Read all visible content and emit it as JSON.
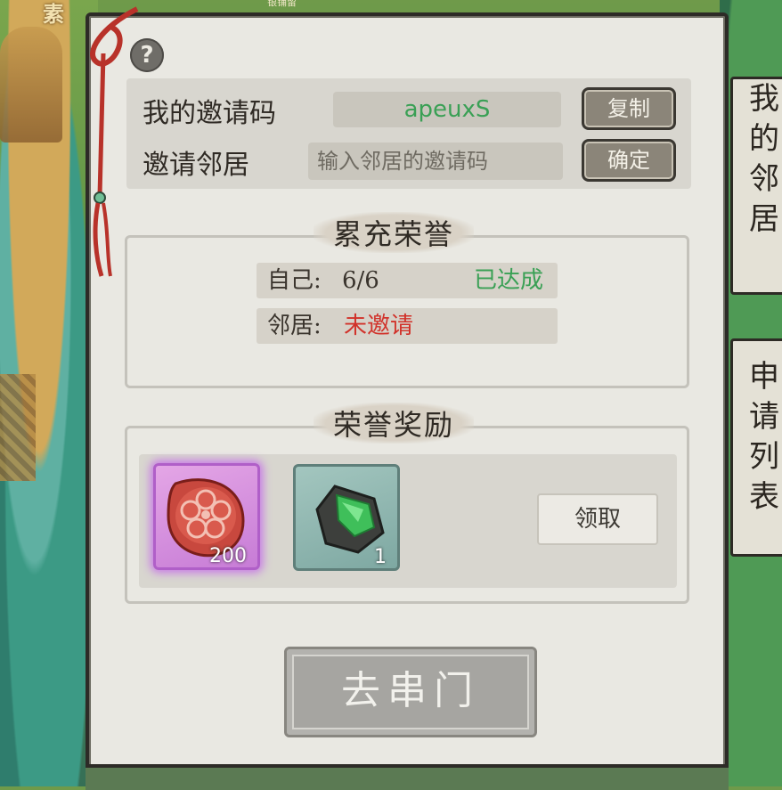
{
  "background": {
    "top_left_label": "素",
    "top_mini_label": "银铺留",
    "side_card_top": [
      "我",
      "的",
      "邻",
      "居"
    ],
    "side_card_bottom": [
      "申",
      "请",
      "列",
      "表"
    ]
  },
  "invite": {
    "my_code_label": "我的邀请码",
    "my_code_value": "apeuxS",
    "copy_button": "复制",
    "invite_label": "邀请邻居",
    "input_placeholder": "输入邻居的邀请码",
    "confirm_button": "确定"
  },
  "progress": {
    "title": "累充荣誉",
    "self_label": "自己:",
    "self_value": "6/6",
    "self_status": "已达成",
    "neighbor_label": "邻居:",
    "neighbor_status": "未邀请"
  },
  "rewards": {
    "title": "荣誉奖励",
    "items": [
      {
        "icon": "plum-blossom-token-icon",
        "count": "200"
      },
      {
        "icon": "jade-stone-icon",
        "count": "1"
      }
    ],
    "claim_button": "领取"
  },
  "visit_button": "去串门",
  "colors": {
    "success": "#3aa055",
    "warning": "#d1322a",
    "panel": "#e9e8e2"
  }
}
